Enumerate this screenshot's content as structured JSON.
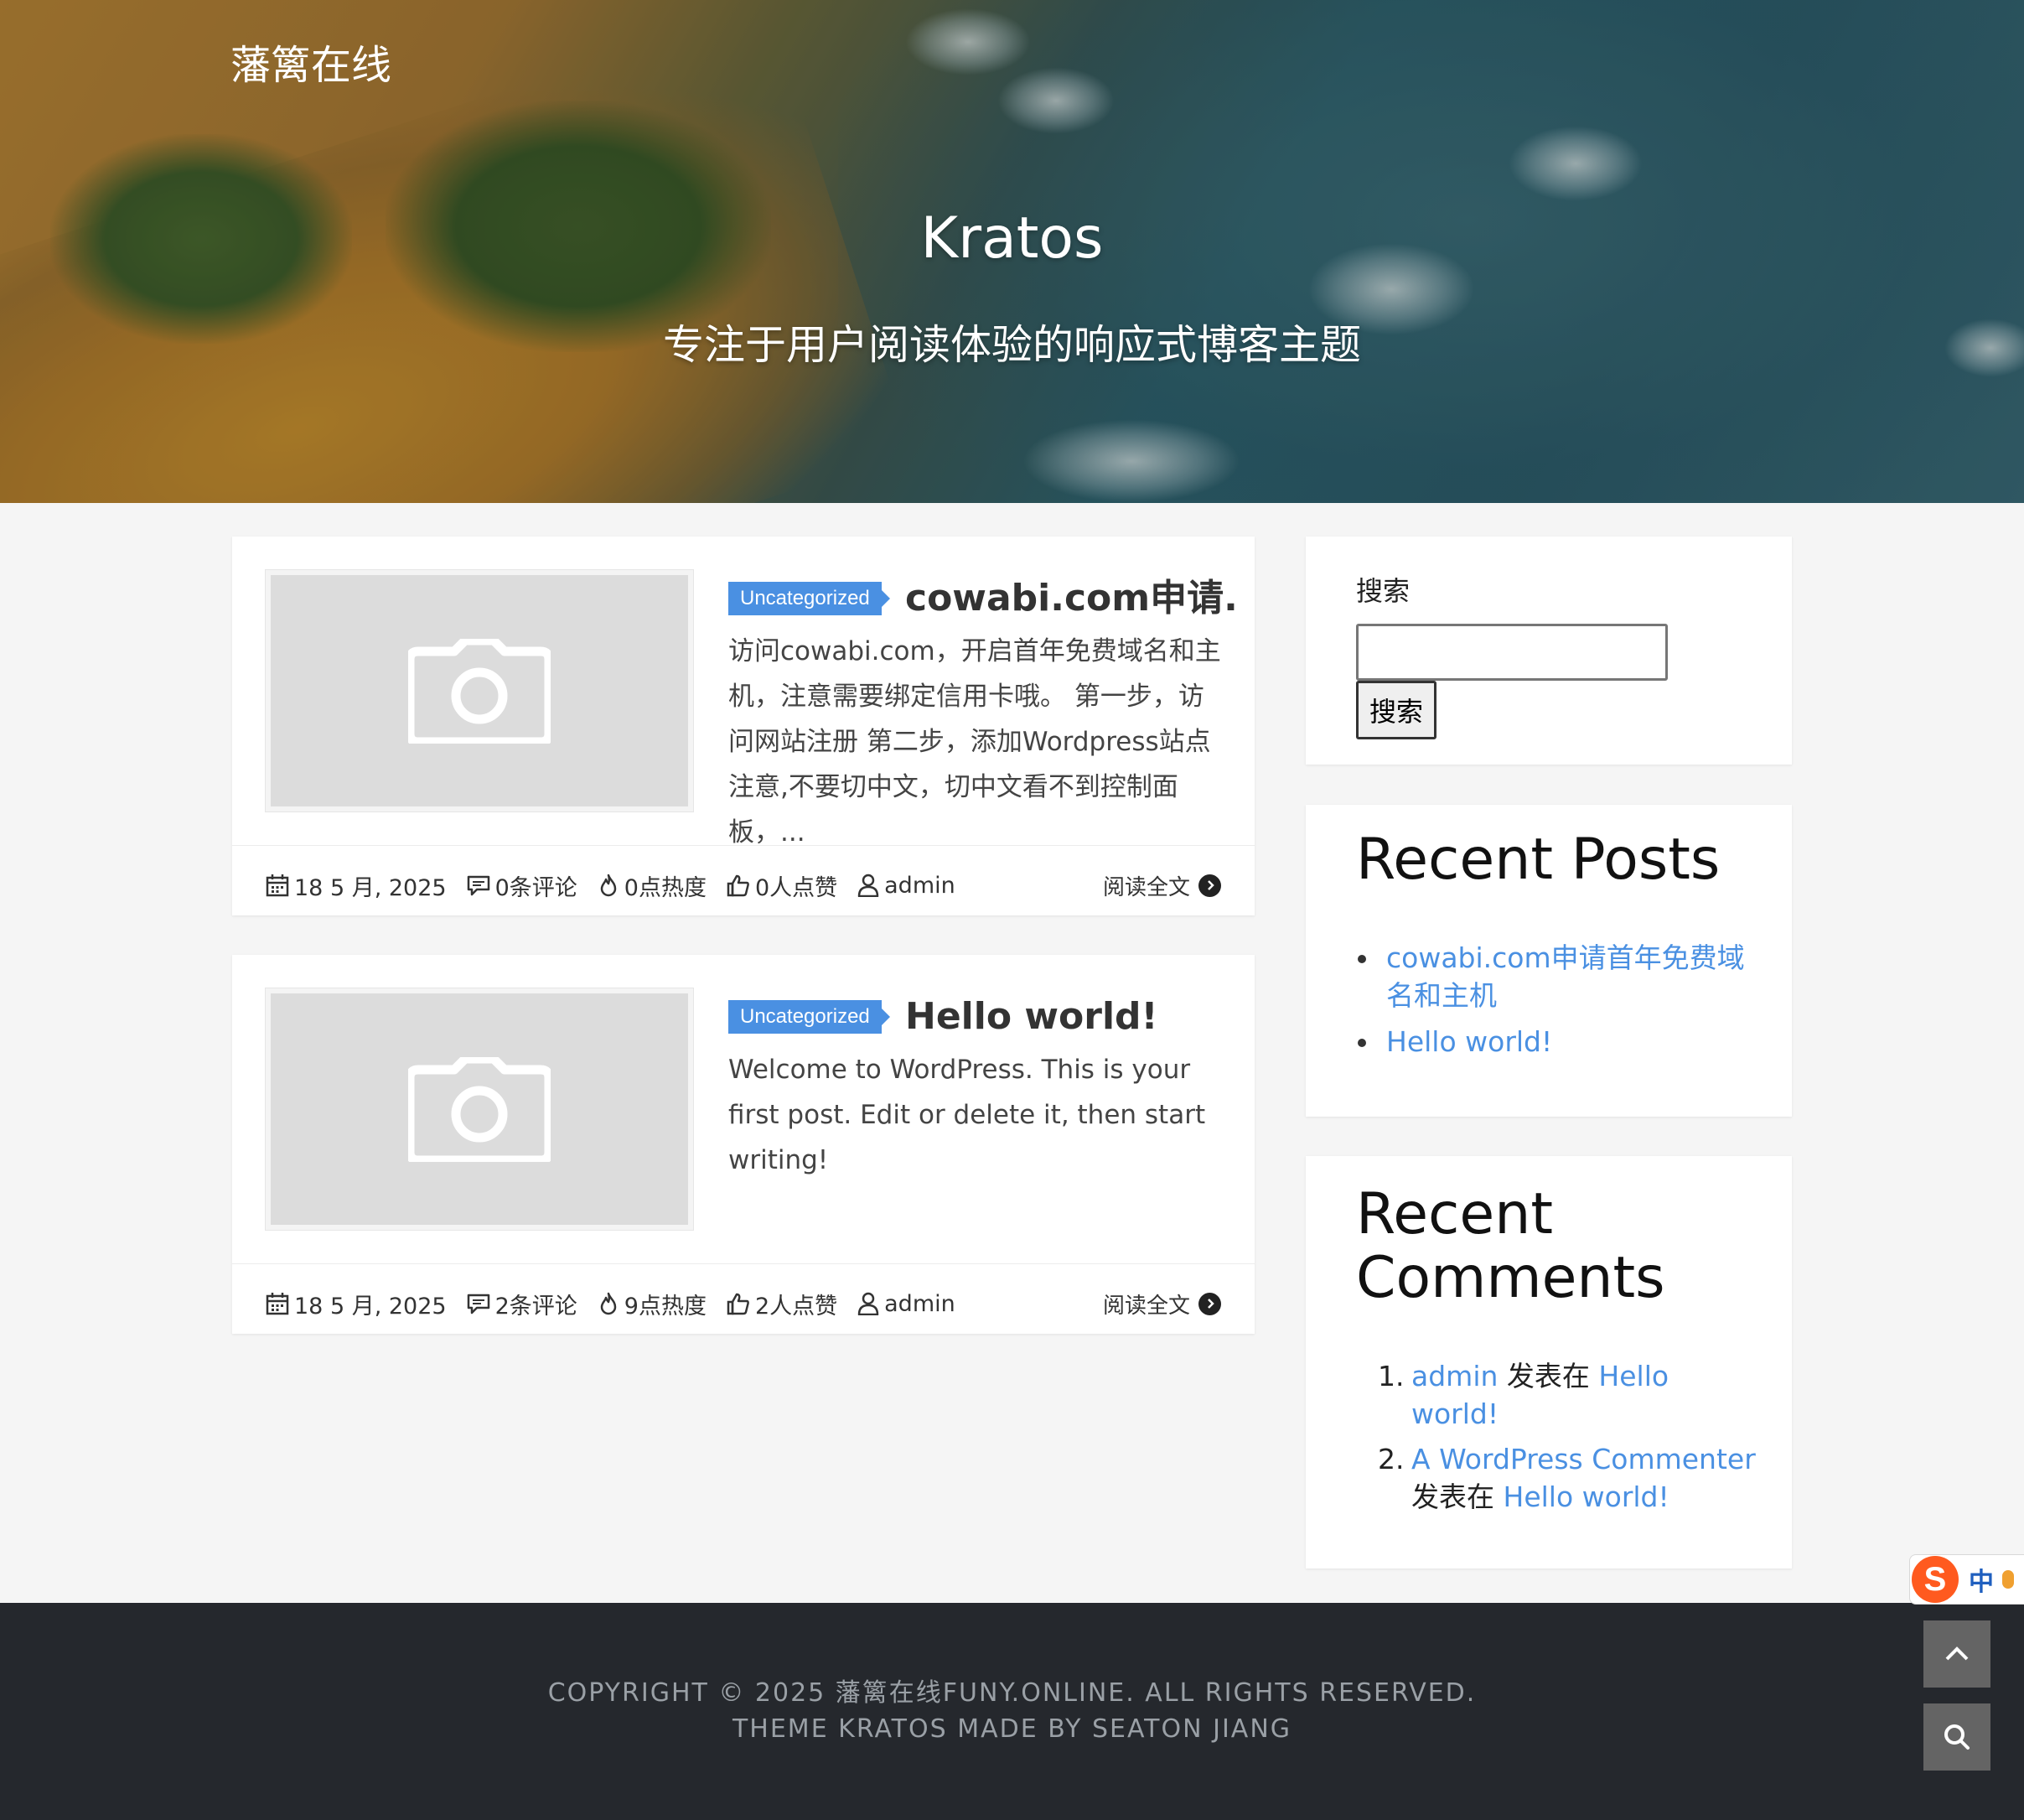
{
  "site": {
    "brand": "藩篱在线",
    "title": "Kratos",
    "subtitle": "专注于用户阅读体验的响应式博客主题"
  },
  "posts": [
    {
      "category": "Uncategorized",
      "title": "cowabi.com申请...",
      "excerpt": "访问cowabi.com，开启首年免费域名和主机，注意需要绑定信用卡哦。 第一步，访问网站注册 第二步，添加Wordpress站点 注意,不要切中文，切中文看不到控制面板，...",
      "date": "18 5 月, 2025",
      "comments": "0条评论",
      "views": "0点热度",
      "likes": "0人点赞",
      "author": "admin",
      "read_more": "阅读全文"
    },
    {
      "category": "Uncategorized",
      "title": "Hello world!",
      "excerpt": "Welcome to WordPress. This is your first post. Edit or delete it, then start writing!",
      "date": "18 5 月, 2025",
      "comments": "2条评论",
      "views": "9点热度",
      "likes": "2人点赞",
      "author": "admin",
      "read_more": "阅读全文"
    }
  ],
  "sidebar": {
    "search": {
      "label": "搜索",
      "placeholder": "",
      "button": "搜索"
    },
    "recent_posts": {
      "title": "Recent Posts",
      "items": [
        "cowabi.com申请首年免费域名和主机",
        "Hello world!"
      ]
    },
    "recent_comments": {
      "title": "Recent Comments",
      "items": [
        {
          "num": "1.",
          "author": "admin",
          "connector": "发表在",
          "post": "Hello world!"
        },
        {
          "num": "2.",
          "author": "A WordPress Commenter",
          "connector": "发表在",
          "post": "Hello world!"
        }
      ]
    }
  },
  "footer": {
    "line1": "COPYRIGHT © 2025 藩篱在线FUNY.ONLINE. ALL RIGHTS RESERVED.",
    "line2": "THEME KRATOS MADE BY SEATON JIANG"
  },
  "ime": {
    "logo": "S",
    "mode": "中"
  },
  "icons": {
    "calendar": "calendar-icon",
    "comment": "comment-icon",
    "fire": "fire-icon",
    "thumb": "thumbs-up-icon",
    "user": "user-icon",
    "arrow": "arrow-right-icon",
    "camera": "camera-placeholder-icon",
    "up": "chevron-up-icon",
    "search": "search-icon"
  },
  "colors": {
    "accent": "#4a90e2",
    "footer_bg": "#25282d",
    "float_btn": "#646464",
    "page_bg": "#f5f5f5"
  }
}
